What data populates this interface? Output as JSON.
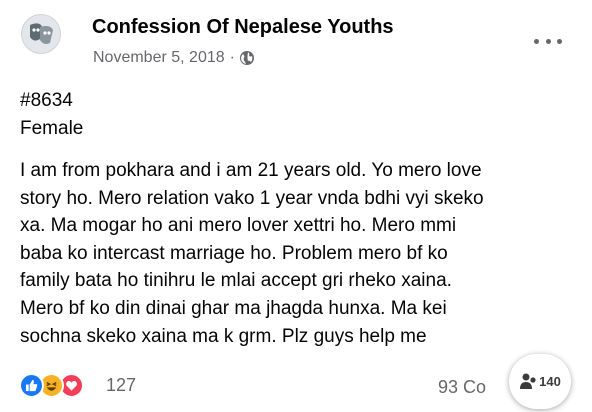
{
  "post": {
    "page_name": "Confession Of Nepalese Youths",
    "date": "November 5, 2018",
    "separator": "·",
    "privacy_icon": "globe-icon",
    "more_icon": "more-options-icon",
    "post_id": "#8634",
    "gender": "Female",
    "body_lines": [
      "I am from pokhara and i am 21 years old. Yo mero love",
      "story ho. Mero relation vako 1 year vnda bdhi vyi skeko",
      "xa. Ma mogar ho ani mero lover xettri ho. Mero mmi",
      "baba ko intercast marriage ho. Problem mero bf ko",
      "family bata ho tinihru le mlai accept gri rheko xaina.",
      "Mero bf ko din dinai ghar ma jhagda hunxa. Ma kei",
      "sochna skeko xaina ma k grm. Plz guys help me"
    ]
  },
  "footer": {
    "reaction_icons": [
      "like-icon",
      "haha-icon",
      "love-icon"
    ],
    "reaction_count": "127",
    "comments": "93 Co",
    "viewers_count": "140"
  },
  "colors": {
    "text": "#050505",
    "secondary": "#65676b",
    "like": "#1877f2",
    "haha": "#f7b125",
    "love": "#f33e58"
  }
}
